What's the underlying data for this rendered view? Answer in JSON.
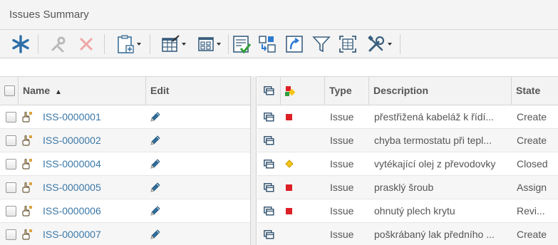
{
  "panel": {
    "title": "Issues Summary"
  },
  "toolbar": {
    "icons": [
      "add-icon",
      "tools-icon",
      "delete-icon",
      "paste-icon",
      "edit-table-icon",
      "columns-icon",
      "validate-icon",
      "move-icon",
      "open-icon",
      "filter-icon",
      "fit-icon",
      "settings-icon"
    ]
  },
  "left_table": {
    "headers": {
      "name": "Name",
      "sort_indicator": "▲",
      "edit": "Edit"
    },
    "rows": [
      {
        "name": "ISS-0000001"
      },
      {
        "name": "ISS-0000002"
      },
      {
        "name": "ISS-0000004"
      },
      {
        "name": "ISS-0000005"
      },
      {
        "name": "ISS-0000006"
      },
      {
        "name": "ISS-0000007"
      }
    ]
  },
  "right_table": {
    "headers": {
      "type": "Type",
      "description": "Description",
      "state": "State"
    },
    "rows": [
      {
        "flag": "red",
        "type": "Issue",
        "description": "přestřižená kabeláž k řídí...",
        "state": "Create"
      },
      {
        "flag": "none",
        "type": "Issue",
        "description": "chyba termostatu při tepl...",
        "state": "Create"
      },
      {
        "flag": "yellow",
        "type": "Issue",
        "description": "vytékající olej z převodovky",
        "state": "Closed"
      },
      {
        "flag": "red",
        "type": "Issue",
        "description": "prasklý šroub",
        "state": "Assign"
      },
      {
        "flag": "red",
        "type": "Issue",
        "description": "ohnutý plech krytu",
        "state": "Revi..."
      },
      {
        "flag": "none",
        "type": "Issue",
        "description": "poškrábaný lak předního ...",
        "state": "Create"
      }
    ]
  },
  "colors": {
    "link": "#3a78a8",
    "flag_red": "#dd1f26",
    "flag_yellow": "#f5c518",
    "header_bg": "#f3f3f3"
  }
}
